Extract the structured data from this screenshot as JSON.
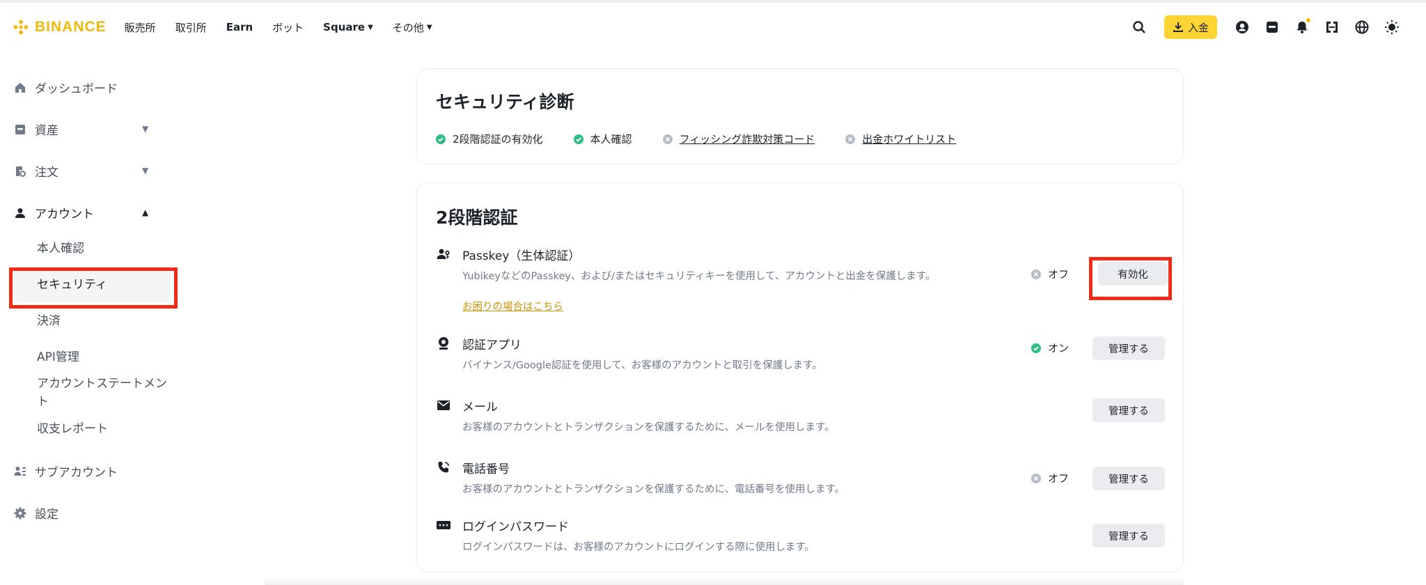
{
  "brand": {
    "name": "BINANCE",
    "color": "#F0B90B"
  },
  "nav": {
    "items": [
      "販売所",
      "取引所",
      "Earn",
      "ボット",
      "Square",
      "その他"
    ]
  },
  "header": {
    "deposit_label": "入金",
    "icons": [
      "search-icon",
      "download-icon",
      "user-icon",
      "wallet-icon",
      "bell-icon",
      "qr-icon",
      "globe-icon",
      "theme-icon"
    ]
  },
  "sidebar": {
    "items": [
      {
        "label": "ダッシュボード",
        "icon": "home-icon"
      },
      {
        "label": "資産",
        "icon": "wallet-icon"
      },
      {
        "label": "注文",
        "icon": "order-icon"
      },
      {
        "label": "アカウント",
        "icon": "user-icon"
      },
      {
        "label": "サブアカウント",
        "icon": "subaccount-icon"
      },
      {
        "label": "設定",
        "icon": "gear-icon"
      }
    ],
    "account_sub": [
      "本人確認",
      "セキュリティ",
      "決済",
      "API管理",
      "アカウントステートメント",
      "収支レポート"
    ]
  },
  "diagnosis": {
    "title": "セキュリティ診断",
    "items": [
      {
        "label": "2段階認証の有効化",
        "status": "ok"
      },
      {
        "label": "本人確認",
        "status": "ok"
      },
      {
        "label": "フィッシング詐欺対策コード",
        "status": "off"
      },
      {
        "label": "出金ホワイトリスト",
        "status": "off"
      }
    ]
  },
  "two_factor": {
    "title": "2段階認証",
    "rows": [
      {
        "title": "Passkey（生体認証）",
        "desc": "YubikeyなどのPasskey、および/またはセキュリティキーを使用して、アカウントと出金を保護します。",
        "help": "お困りの場合はこちら",
        "status": "オフ",
        "button": "有効化"
      },
      {
        "title": "認証アプリ",
        "desc": "バイナンス/Google認証を使用して、お客様のアカウントと取引を保護します。",
        "status": "オン",
        "button": "管理する"
      },
      {
        "title": "メール",
        "desc": "お客様のアカウントとトランザクションを保護するために、メールを使用します。",
        "button": "管理する"
      },
      {
        "title": "電話番号",
        "desc": "お客様のアカウントとトランザクションを保護するために、電話番号を使用します。",
        "status": "オフ",
        "button": "管理する"
      },
      {
        "title": "ログインパスワード",
        "desc": "ログインパスワードは、お客様のアカウントにログインする際に使用します。",
        "button": "管理する"
      }
    ]
  },
  "colors": {
    "accent": "#FCD535",
    "ok": "#2EBD85",
    "muted": "#B7BDC6",
    "highlight": "#F12B16"
  }
}
